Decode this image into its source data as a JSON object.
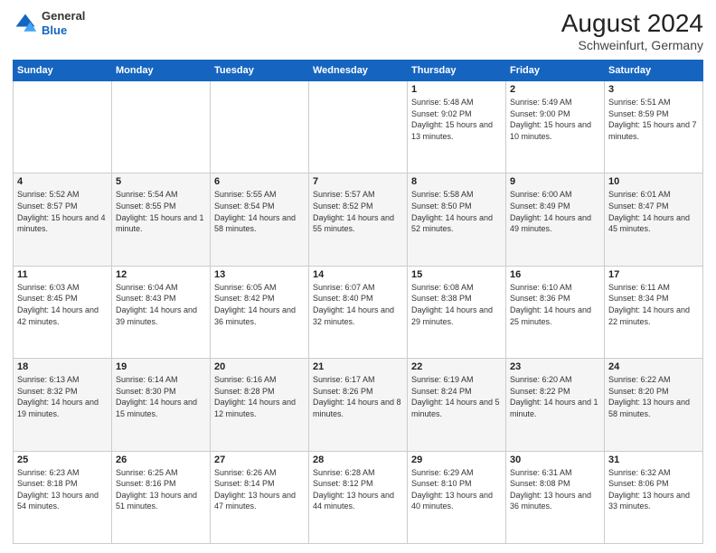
{
  "header": {
    "logo": {
      "general": "General",
      "blue": "Blue"
    },
    "title": "August 2024",
    "location": "Schweinfurt, Germany"
  },
  "weekdays": [
    "Sunday",
    "Monday",
    "Tuesday",
    "Wednesday",
    "Thursday",
    "Friday",
    "Saturday"
  ],
  "weeks": [
    [
      {
        "day": "",
        "info": ""
      },
      {
        "day": "",
        "info": ""
      },
      {
        "day": "",
        "info": ""
      },
      {
        "day": "",
        "info": ""
      },
      {
        "day": "1",
        "info": "Sunrise: 5:48 AM\nSunset: 9:02 PM\nDaylight: 15 hours and 13 minutes."
      },
      {
        "day": "2",
        "info": "Sunrise: 5:49 AM\nSunset: 9:00 PM\nDaylight: 15 hours and 10 minutes."
      },
      {
        "day": "3",
        "info": "Sunrise: 5:51 AM\nSunset: 8:59 PM\nDaylight: 15 hours and 7 minutes."
      }
    ],
    [
      {
        "day": "4",
        "info": "Sunrise: 5:52 AM\nSunset: 8:57 PM\nDaylight: 15 hours and 4 minutes."
      },
      {
        "day": "5",
        "info": "Sunrise: 5:54 AM\nSunset: 8:55 PM\nDaylight: 15 hours and 1 minute."
      },
      {
        "day": "6",
        "info": "Sunrise: 5:55 AM\nSunset: 8:54 PM\nDaylight: 14 hours and 58 minutes."
      },
      {
        "day": "7",
        "info": "Sunrise: 5:57 AM\nSunset: 8:52 PM\nDaylight: 14 hours and 55 minutes."
      },
      {
        "day": "8",
        "info": "Sunrise: 5:58 AM\nSunset: 8:50 PM\nDaylight: 14 hours and 52 minutes."
      },
      {
        "day": "9",
        "info": "Sunrise: 6:00 AM\nSunset: 8:49 PM\nDaylight: 14 hours and 49 minutes."
      },
      {
        "day": "10",
        "info": "Sunrise: 6:01 AM\nSunset: 8:47 PM\nDaylight: 14 hours and 45 minutes."
      }
    ],
    [
      {
        "day": "11",
        "info": "Sunrise: 6:03 AM\nSunset: 8:45 PM\nDaylight: 14 hours and 42 minutes."
      },
      {
        "day": "12",
        "info": "Sunrise: 6:04 AM\nSunset: 8:43 PM\nDaylight: 14 hours and 39 minutes."
      },
      {
        "day": "13",
        "info": "Sunrise: 6:05 AM\nSunset: 8:42 PM\nDaylight: 14 hours and 36 minutes."
      },
      {
        "day": "14",
        "info": "Sunrise: 6:07 AM\nSunset: 8:40 PM\nDaylight: 14 hours and 32 minutes."
      },
      {
        "day": "15",
        "info": "Sunrise: 6:08 AM\nSunset: 8:38 PM\nDaylight: 14 hours and 29 minutes."
      },
      {
        "day": "16",
        "info": "Sunrise: 6:10 AM\nSunset: 8:36 PM\nDaylight: 14 hours and 25 minutes."
      },
      {
        "day": "17",
        "info": "Sunrise: 6:11 AM\nSunset: 8:34 PM\nDaylight: 14 hours and 22 minutes."
      }
    ],
    [
      {
        "day": "18",
        "info": "Sunrise: 6:13 AM\nSunset: 8:32 PM\nDaylight: 14 hours and 19 minutes."
      },
      {
        "day": "19",
        "info": "Sunrise: 6:14 AM\nSunset: 8:30 PM\nDaylight: 14 hours and 15 minutes."
      },
      {
        "day": "20",
        "info": "Sunrise: 6:16 AM\nSunset: 8:28 PM\nDaylight: 14 hours and 12 minutes."
      },
      {
        "day": "21",
        "info": "Sunrise: 6:17 AM\nSunset: 8:26 PM\nDaylight: 14 hours and 8 minutes."
      },
      {
        "day": "22",
        "info": "Sunrise: 6:19 AM\nSunset: 8:24 PM\nDaylight: 14 hours and 5 minutes."
      },
      {
        "day": "23",
        "info": "Sunrise: 6:20 AM\nSunset: 8:22 PM\nDaylight: 14 hours and 1 minute."
      },
      {
        "day": "24",
        "info": "Sunrise: 6:22 AM\nSunset: 8:20 PM\nDaylight: 13 hours and 58 minutes."
      }
    ],
    [
      {
        "day": "25",
        "info": "Sunrise: 6:23 AM\nSunset: 8:18 PM\nDaylight: 13 hours and 54 minutes."
      },
      {
        "day": "26",
        "info": "Sunrise: 6:25 AM\nSunset: 8:16 PM\nDaylight: 13 hours and 51 minutes."
      },
      {
        "day": "27",
        "info": "Sunrise: 6:26 AM\nSunset: 8:14 PM\nDaylight: 13 hours and 47 minutes."
      },
      {
        "day": "28",
        "info": "Sunrise: 6:28 AM\nSunset: 8:12 PM\nDaylight: 13 hours and 44 minutes."
      },
      {
        "day": "29",
        "info": "Sunrise: 6:29 AM\nSunset: 8:10 PM\nDaylight: 13 hours and 40 minutes."
      },
      {
        "day": "30",
        "info": "Sunrise: 6:31 AM\nSunset: 8:08 PM\nDaylight: 13 hours and 36 minutes."
      },
      {
        "day": "31",
        "info": "Sunrise: 6:32 AM\nSunset: 8:06 PM\nDaylight: 13 hours and 33 minutes."
      }
    ]
  ]
}
